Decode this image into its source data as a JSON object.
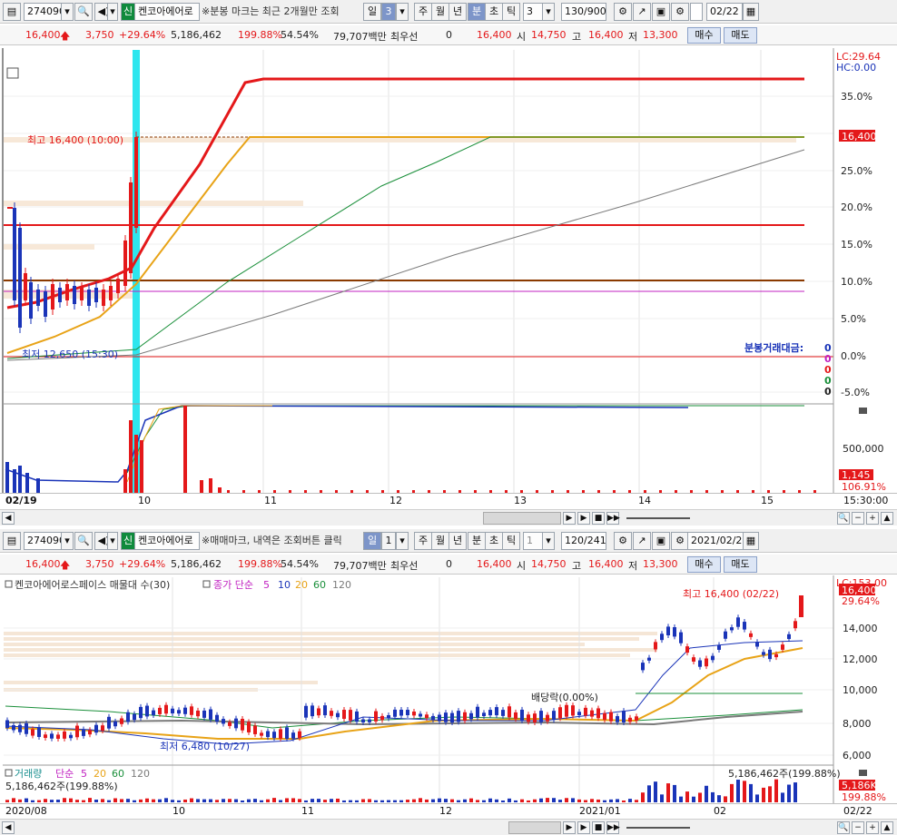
{
  "top": {
    "code": "274090",
    "name": "켄코아에어로",
    "shin": "신",
    "notice": "※분봉 마크는 최근 2개월만 조회",
    "period_tabs": [
      "일",
      "3",
      "주",
      "월",
      "년",
      "분",
      "초",
      "틱"
    ],
    "interval": "3",
    "count": "130/900",
    "date": "02/22",
    "info": {
      "price": "16,400",
      "change": "3,750",
      "rate": "+29.64%",
      "volume": "5,186,462",
      "vol_ratio": "199.88%",
      "turnover": "54.54%",
      "amount": "79,707백만",
      "best": "최우선",
      "zero": "0",
      "ask": "16,400",
      "open_lbl": "시",
      "open": "14,750",
      "high_lbl": "고",
      "high": "16,400",
      "low_lbl": "저",
      "low": "13,300",
      "buy": "매수",
      "sell": "매도"
    },
    "chart": {
      "lc": "LC:29.64",
      "hc": "HC:0.00",
      "high_note": "최고 16,400 (10:00)",
      "low_note": "최저 12,650 (15:30)",
      "right_price": "16,400",
      "pct_ticks": [
        "35.0%",
        "30.0%",
        "25.0%",
        "20.0%",
        "15.0%",
        "10.0%",
        "5.0%",
        "0.0%",
        "-5.0%"
      ],
      "amount_label": "분봉거래대금:",
      "amount_vals": [
        "0",
        "0",
        "0",
        "0",
        "0"
      ],
      "vol_tick": "500,000",
      "vol_val": "1,145",
      "vol_pct": "106.91%",
      "dates": [
        "02/19",
        "10",
        "11",
        "12",
        "13",
        "14",
        "15",
        "15:30:00"
      ]
    }
  },
  "bottom": {
    "code": "274090",
    "name": "켄코아에어로",
    "shin": "신",
    "notice": "※매매마크, 내역은 조회버튼 클릭",
    "period_tabs": [
      "일",
      "1",
      "주",
      "월",
      "년",
      "분",
      "초",
      "틱"
    ],
    "interval": "1",
    "count": "120/241",
    "date": "2021/02/22",
    "info": {
      "price": "16,400",
      "change": "3,750",
      "rate": "+29.64%",
      "volume": "5,186,462",
      "vol_ratio": "199.88%",
      "turnover": "54.54%",
      "amount": "79,707백만",
      "best": "최우선",
      "zero": "0",
      "ask": "16,400",
      "open_lbl": "시",
      "open": "14,750",
      "high_lbl": "고",
      "high": "16,400",
      "low_lbl": "저",
      "low": "13,300",
      "buy": "매수",
      "sell": "매도"
    },
    "chart": {
      "legend_name": "켄코아에어로스페이스 매물대 수(30)",
      "legend_ma": "종가 단순",
      "ma_periods": [
        "5",
        "10",
        "20",
        "60",
        "120"
      ],
      "lc": "LC:153.00",
      "right_price": "16,400",
      "right_pct": "29.64%",
      "high_note": "최고 16,400 (02/22)",
      "low_note": "최저 6,480 (10/27)",
      "div_note": "배당락(0.00%)",
      "price_ticks": [
        "14,000",
        "12,000",
        "10,000",
        "8,000",
        "6,000"
      ],
      "vol_legend": "거래량",
      "vol_ma": "단순",
      "vol_periods": [
        "5",
        "20",
        "60",
        "120"
      ],
      "vol_value": "5,186,462주(199.88%)",
      "vol_value_right": "5,186,462주(199.88%)",
      "vol_right": "5,186K",
      "vol_right_pct": "199.88%",
      "dates": [
        "2020/08",
        "10",
        "11",
        "12",
        "2021/01",
        "02",
        "02/22"
      ]
    }
  },
  "colors": {
    "up": "#e4181a",
    "down": "#1a34b8",
    "cyan": "#2ee6ee",
    "orange": "#e8a317",
    "green": "#1a8f3a",
    "gray": "#7a7a7a",
    "magenta": "#c020c0"
  },
  "icons": [
    "menu-icon",
    "search-icon",
    "speaker-icon",
    "dropdown-icon",
    "compare-icon",
    "save-icon",
    "gear-icon",
    "zoom-icon",
    "plus-icon",
    "minus-icon",
    "play-icon",
    "stop-icon",
    "fast-forward-icon"
  ]
}
